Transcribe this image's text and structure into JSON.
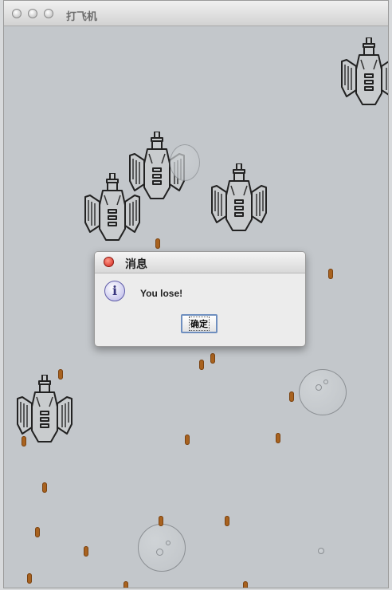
{
  "window": {
    "title": "打飞机"
  },
  "dialog": {
    "title": "消息",
    "message": "You lose!",
    "ok_label": "确定",
    "icon": "info-icon"
  },
  "game": {
    "enemy_count": 5,
    "bullet_count": 17,
    "rock_count": 4
  },
  "colors": {
    "background": "#c3c7cb",
    "bullet": "#a8621f"
  }
}
